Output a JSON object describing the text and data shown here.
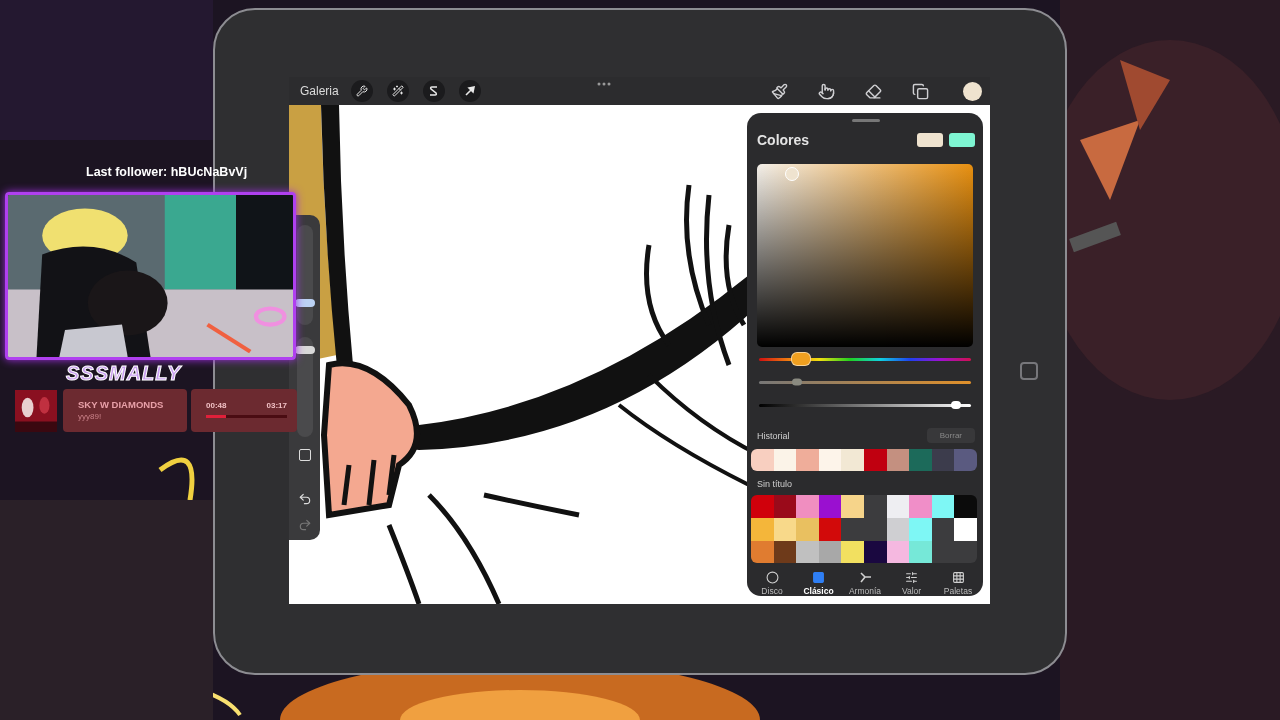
{
  "stream_overlay": {
    "last_follower": "Last follower: hBUcNaBvVj",
    "streamer_name": "SSSMALLY",
    "now_playing": {
      "title": "SKY W DIAMONDS",
      "artist": "yyy89!",
      "elapsed": "00:48",
      "duration": "03:17",
      "level": 0.25
    }
  },
  "toolbar": {
    "gallery": "Galeria"
  },
  "sidebar": {
    "sliders": [
      {
        "kind": "size",
        "level": 0.2
      },
      {
        "kind": "opacity",
        "level": 0.9
      }
    ]
  },
  "colors_panel": {
    "title": "Colores",
    "sliders": [
      {
        "kind": "hue",
        "level": 0.2
      },
      {
        "kind": "saturation",
        "level": 0.18
      },
      {
        "kind": "brightness",
        "level": 0.93
      }
    ],
    "history": {
      "label": "Historial",
      "clear_button": "Borrar",
      "swatches": [
        {
          "color": "#f8cfc0"
        },
        {
          "color": "#fbf3e8"
        },
        {
          "color": "#efad9a"
        },
        {
          "color": "#fdf4ea"
        },
        {
          "color": "#f2e8d4"
        },
        {
          "color": "#c00010"
        },
        {
          "color": "#c49080"
        },
        {
          "color": "#1c6a5a"
        },
        {
          "color": "#3c3c4c"
        },
        {
          "color": "#5a5a80"
        }
      ]
    },
    "palette": {
      "name": "Sin título",
      "swatches": [
        {
          "color": "#d0000b"
        },
        {
          "color": "#9a0a1a"
        },
        {
          "color": "#f08ec0"
        },
        {
          "color": "#9a10d0"
        },
        {
          "color": "#f6d48a"
        },
        {
          "color": "#3c3c3e"
        },
        {
          "color": "#eeeef2"
        },
        {
          "color": "#f08ec8"
        },
        {
          "color": "#7ef7f5"
        },
        {
          "color": "#0b0b0b"
        },
        {
          "color": "#f4b63a"
        },
        {
          "color": "#f8d98a"
        },
        {
          "color": "#e9c060"
        },
        {
          "color": "#d20a0a"
        },
        {
          "color": "#3c3c3e"
        },
        {
          "color": "#3c3c3e"
        },
        {
          "color": "#cfcfd2"
        },
        {
          "color": "#7ef7f5"
        },
        {
          "color": "#3c3c3e"
        },
        {
          "color": "#ffffff"
        },
        {
          "color": "#e07c30"
        },
        {
          "color": "#6e3a1a"
        },
        {
          "color": "#c0c0c0"
        },
        {
          "color": "#a8a8a8"
        },
        {
          "color": "#f2e060"
        },
        {
          "color": "#1a0840"
        },
        {
          "color": "#f5b8e0"
        },
        {
          "color": "#76e8d8"
        },
        {
          "color": "#3c3c3e"
        },
        {
          "color": "#3c3c3e"
        }
      ]
    },
    "tabs": [
      {
        "kind": "disc",
        "label": "Disco",
        "selected": false
      },
      {
        "kind": "classic",
        "label": "Clásico",
        "selected": true
      },
      {
        "kind": "harmony",
        "label": "Armonía",
        "selected": false
      },
      {
        "kind": "value",
        "label": "Valor",
        "selected": false
      },
      {
        "kind": "palettes",
        "label": "Paletas",
        "selected": false
      }
    ]
  }
}
